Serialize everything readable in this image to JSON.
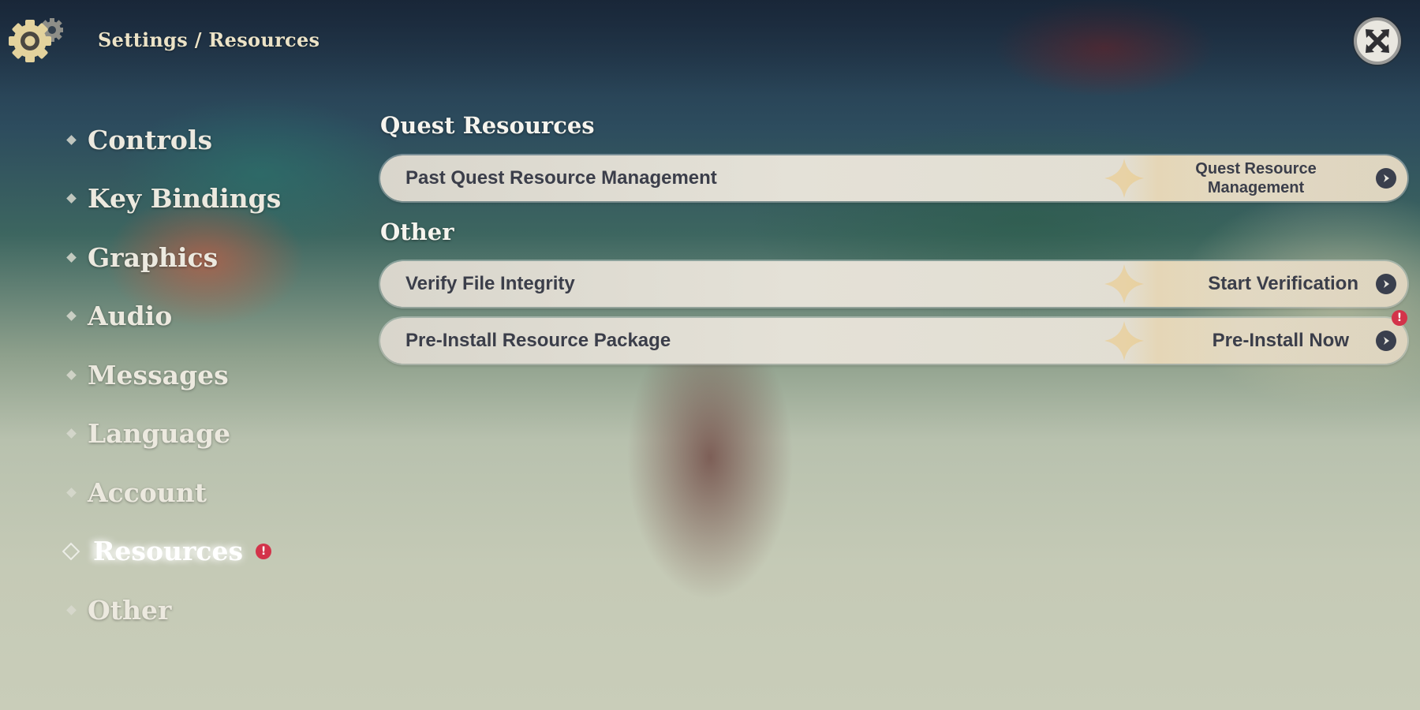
{
  "header": {
    "icon": "gear-icon",
    "breadcrumb": "Settings / Resources",
    "close_icon": "close-icon"
  },
  "sidebar": {
    "items": [
      {
        "label": "Controls",
        "active": false,
        "badge": null
      },
      {
        "label": "Key Bindings",
        "active": false,
        "badge": null
      },
      {
        "label": "Graphics",
        "active": false,
        "badge": null
      },
      {
        "label": "Audio",
        "active": false,
        "badge": null
      },
      {
        "label": "Messages",
        "active": false,
        "badge": null
      },
      {
        "label": "Language",
        "active": false,
        "badge": null
      },
      {
        "label": "Account",
        "active": false,
        "badge": null
      },
      {
        "label": "Resources",
        "active": true,
        "badge": "!"
      },
      {
        "label": "Other",
        "active": false,
        "badge": null
      }
    ]
  },
  "main": {
    "sections": [
      {
        "title": "Quest Resources",
        "rows": [
          {
            "label": "Past Quest Resource Management",
            "action": "Quest Resource Management",
            "action_lines": [
              "Quest Resource",
              "Management"
            ],
            "badge": null
          }
        ]
      },
      {
        "title": "Other",
        "rows": [
          {
            "label": "Verify File Integrity",
            "action": "Start Verification",
            "badge": null
          },
          {
            "label": "Pre-Install Resource Package",
            "action": "Pre-Install Now",
            "badge": "!"
          }
        ]
      }
    ]
  },
  "colors": {
    "accent_text": "#ece3c7",
    "row_background": "#e2ded4",
    "row_text": "#3b3e4a",
    "badge_red": "#d3334a",
    "arrow_button": "#3a3f4d"
  }
}
